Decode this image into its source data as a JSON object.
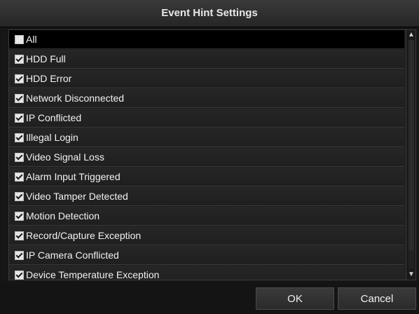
{
  "dialog": {
    "title": "Event Hint Settings"
  },
  "items": [
    {
      "label": "All",
      "checked": false,
      "selected": true
    },
    {
      "label": "HDD Full",
      "checked": true
    },
    {
      "label": "HDD Error",
      "checked": true
    },
    {
      "label": "Network Disconnected",
      "checked": true
    },
    {
      "label": "IP Conflicted",
      "checked": true
    },
    {
      "label": "Illegal Login",
      "checked": true
    },
    {
      "label": "Video Signal Loss",
      "checked": true
    },
    {
      "label": "Alarm Input Triggered",
      "checked": true
    },
    {
      "label": "Video Tamper Detected",
      "checked": true
    },
    {
      "label": "Motion Detection",
      "checked": true
    },
    {
      "label": "Record/Capture Exception",
      "checked": true
    },
    {
      "label": "IP Camera Conflicted",
      "checked": true
    },
    {
      "label": "Device Temperature Exception",
      "checked": true
    }
  ],
  "buttons": {
    "ok": "OK",
    "cancel": "Cancel"
  },
  "icons": {
    "scroll_up": "chevron-up-icon",
    "scroll_down": "chevron-down-icon",
    "checkbox": "checkbox-icon"
  }
}
